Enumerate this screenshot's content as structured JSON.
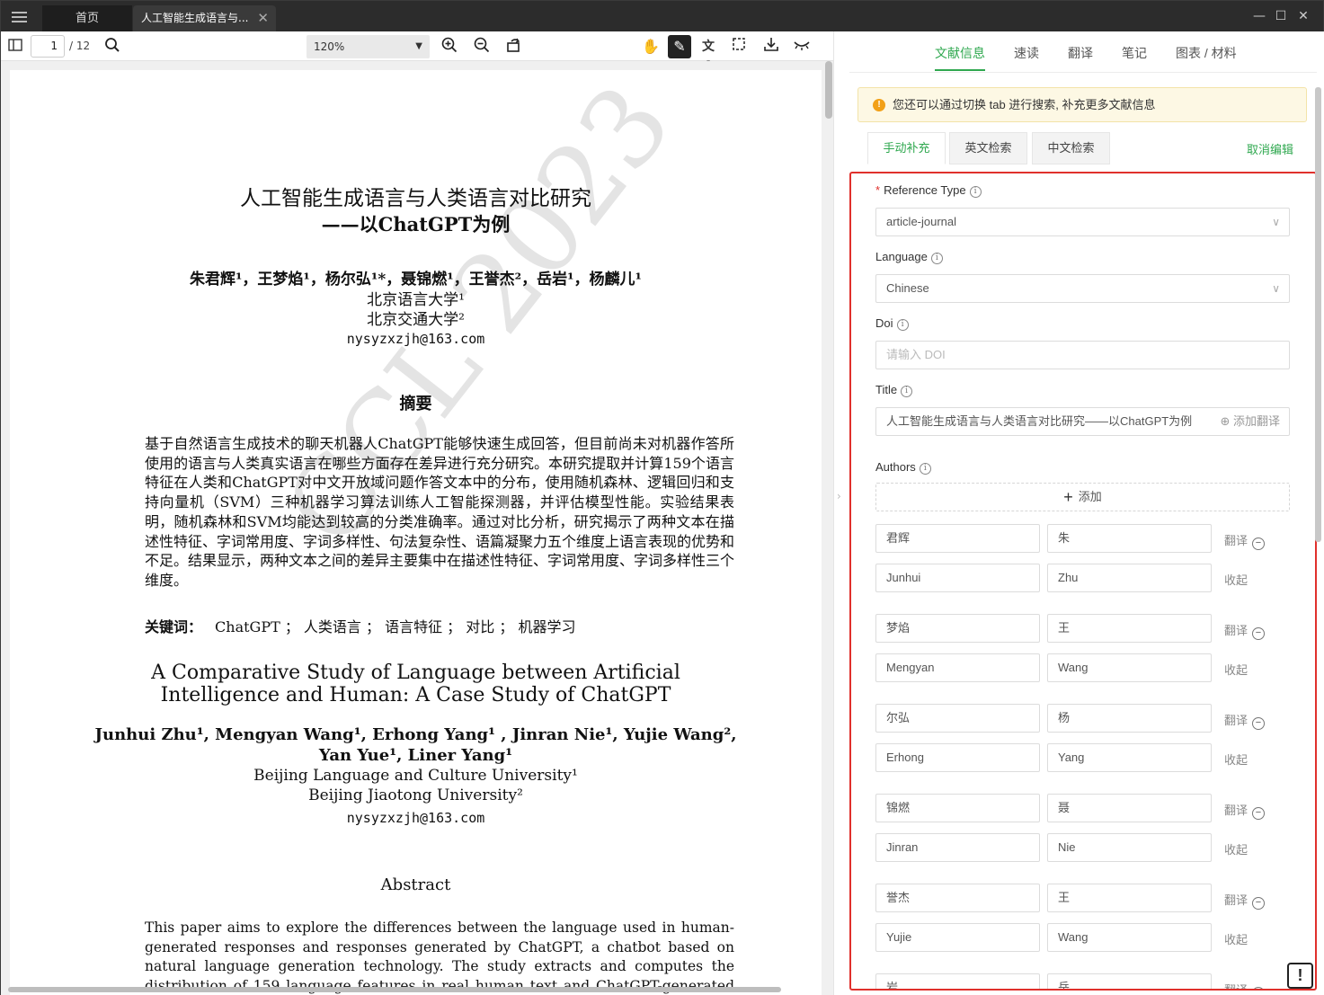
{
  "titlebar": {
    "tabs": [
      {
        "label": "首页"
      },
      {
        "label": "人工智能生成语言与..."
      }
    ]
  },
  "pdf_toolbar": {
    "page_current": "1",
    "page_total": "/ 12",
    "zoom": "120%"
  },
  "pdf": {
    "title": "人工智能生成语言与人类语言对比研究",
    "subtitle": "——以ChatGPT为例",
    "authors_cn": "朱君辉¹，王梦焰¹，杨尔弘¹*，聂锦燃¹，王誉杰²，岳岩¹，杨麟儿¹",
    "aff1_cn": "北京语言大学¹",
    "aff2_cn": "北京交通大学²",
    "email": "nysyzxzjh@163.com",
    "abstract_heading_cn": "摘要",
    "abstract_cn": "基于自然语言生成技术的聊天机器人ChatGPT能够快速生成回答，但目前尚未对机器作答所使用的语言与人类真实语言在哪些方面存在差异进行充分研究。本研究提取并计算159个语言特征在人类和ChatGPT对中文开放域问题作答文本中的分布，使用随机森林、逻辑回归和支持向量机（SVM）三种机器学习算法训练人工智能探测器，并评估模型性能。实验结果表明，随机森林和SVM均能达到较高的分类准确率。通过对比分析，研究揭示了两种文本在描述性特征、字词常用度、字词多样性、句法复杂性、语篇凝聚力五个维度上语言表现的优势和不足。结果显示，两种文本之间的差异主要集中在描述性特征、字词常用度、字词多样性三个维度。",
    "keywords_label": "关键词：",
    "keywords": "ChatGPT ； 人类语言 ； 语言特征 ； 对比 ； 机器学习",
    "en_title_1": "A Comparative Study of Language between Artificial",
    "en_title_2": "Intelligence and Human: A Case Study of ChatGPT",
    "en_authors_1": "Junhui Zhu¹, Mengyan Wang¹, Erhong Yang¹ , Jinran Nie¹, Yujie Wang²,",
    "en_authors_2": "Yan Yue¹, Liner Yang¹",
    "en_aff1": "Beijing Language and Culture University¹",
    "en_aff2": "Beijing Jiaotong University²",
    "en_email": "nysyzxzjh@163.com",
    "abstract_heading_en": "Abstract",
    "abstract_en": "This paper aims to explore the differences between the language used in human-generated responses and responses generated by ChatGPT, a chatbot based on natural language generation technology. The study extracts and computes the distribution of 159 language features in real human text and ChatGPT-generated text. To evaluate",
    "watermark": "CCL 2023"
  },
  "panel": {
    "tabs": [
      "文献信息",
      "速读",
      "翻译",
      "笔记",
      "图表 / 材料"
    ],
    "notice": "您还可以通过切换 tab 进行搜索, 补充更多文献信息",
    "subtabs": [
      "手动补充",
      "英文检索",
      "中文检索"
    ],
    "cancel_edit": "取消编辑",
    "reference_type_label": "Reference Type",
    "reference_type_value": "article-journal",
    "language_label": "Language",
    "language_value": "Chinese",
    "doi_label": "Doi",
    "doi_placeholder": "请输入 DOI",
    "title_label": "Title",
    "title_value": "人工智能生成语言与人类语言对比研究——以ChatGPT为例",
    "add_translation": "⊕ 添加翻译",
    "authors_label": "Authors",
    "add_label": "添加",
    "translate_label": "翻译",
    "collapse_label": "收起",
    "authors": [
      {
        "given_cn": "君辉",
        "family_cn": "朱",
        "given_en": "Junhui",
        "family_en": "Zhu"
      },
      {
        "given_cn": "梦焰",
        "family_cn": "王",
        "given_en": "Mengyan",
        "family_en": "Wang"
      },
      {
        "given_cn": "尔弘",
        "family_cn": "杨",
        "given_en": "Erhong",
        "family_en": "Yang"
      },
      {
        "given_cn": "锦燃",
        "family_cn": "聂",
        "given_en": "Jinran",
        "family_en": "Nie"
      },
      {
        "given_cn": "誉杰",
        "family_cn": "王",
        "given_en": "Yujie",
        "family_en": "Wang"
      },
      {
        "given_cn": "岩",
        "family_cn": "岳",
        "given_en": "",
        "family_en": ""
      }
    ]
  },
  "colors": {
    "accent": "#2fa84f",
    "highlight_border": "#e0302c",
    "titlebar": "#2c2c2c"
  }
}
